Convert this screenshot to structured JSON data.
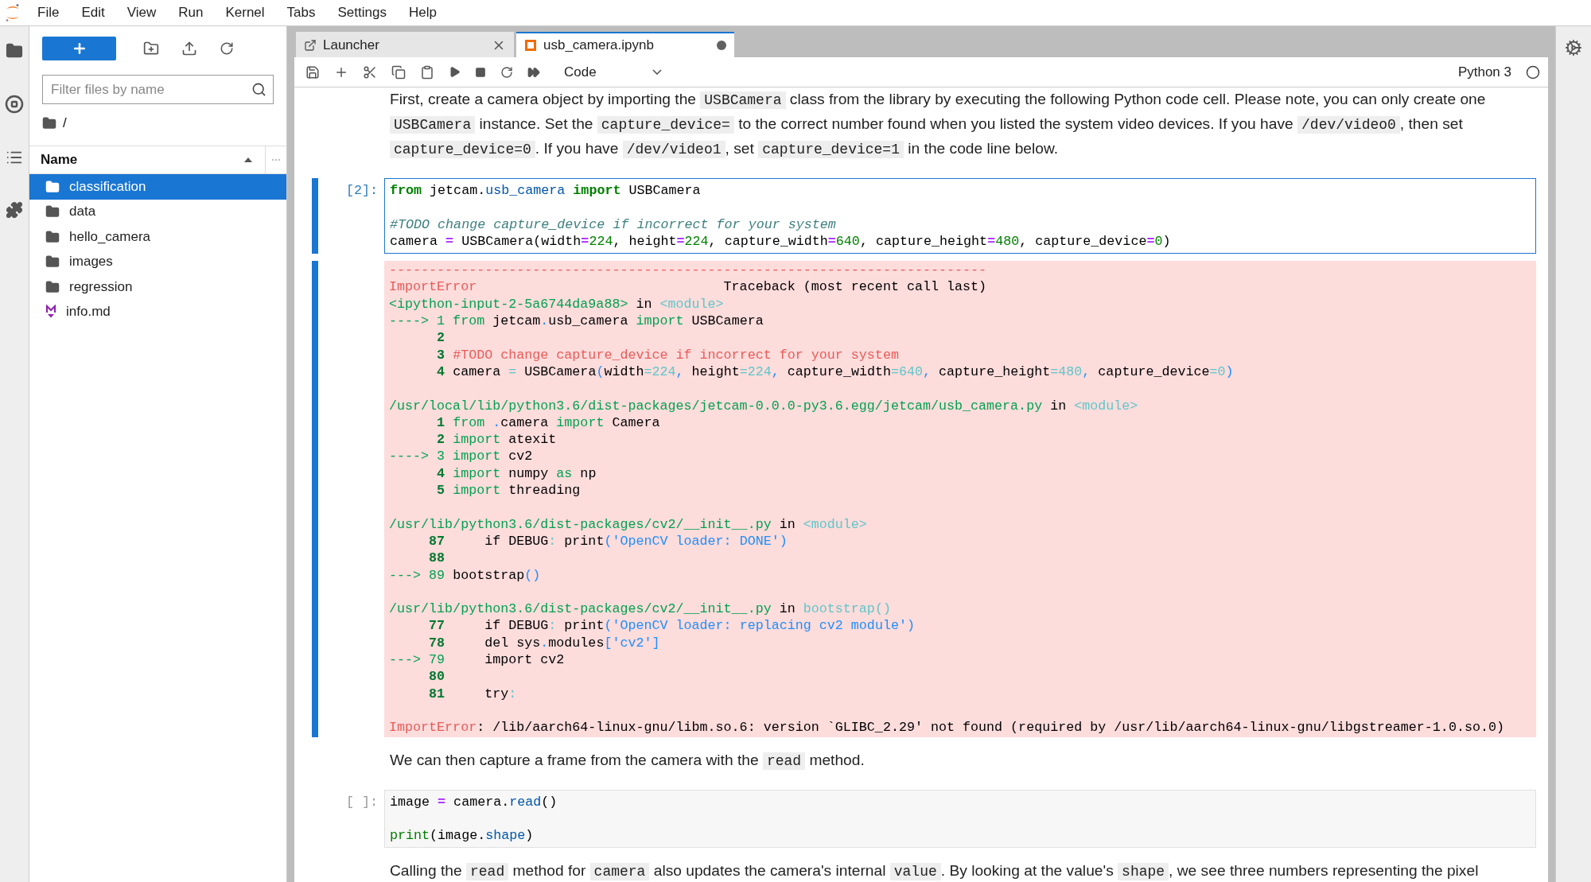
{
  "menu": [
    "File",
    "Edit",
    "View",
    "Run",
    "Kernel",
    "Tabs",
    "Settings",
    "Help"
  ],
  "file_browser": {
    "filter_placeholder": "Filter files by name",
    "path": "/",
    "column": "Name",
    "items": [
      {
        "name": "classification",
        "kind": "folder",
        "selected": true
      },
      {
        "name": "data",
        "kind": "folder",
        "selected": false
      },
      {
        "name": "hello_camera",
        "kind": "folder",
        "selected": false
      },
      {
        "name": "images",
        "kind": "folder",
        "selected": false
      },
      {
        "name": "regression",
        "kind": "folder",
        "selected": false
      },
      {
        "name": "info.md",
        "kind": "markdown",
        "selected": false
      }
    ]
  },
  "tabs": [
    {
      "label": "Launcher",
      "kind": "launcher",
      "selected": false,
      "modified": false
    },
    {
      "label": "usb_camera.ipynb",
      "kind": "notebook",
      "selected": true,
      "modified": true
    }
  ],
  "toolbar": {
    "cell_type": "Code",
    "kernel": "Python 3"
  },
  "cells": [
    {
      "kind": "markdown",
      "segments": [
        {
          "text": "First, create a camera object by importing the ",
          "kind": "text"
        },
        {
          "text": "USBCamera",
          "kind": "code"
        },
        {
          "text": " class from the library by executing the following Python code cell. Please note, you can only create one ",
          "kind": "text"
        },
        {
          "text": "USBCamera",
          "kind": "code"
        },
        {
          "text": " instance. Set the ",
          "kind": "text"
        },
        {
          "text": "capture_device=",
          "kind": "code"
        },
        {
          "text": " to the correct number found when you listed the system video devices. If you have ",
          "kind": "text"
        },
        {
          "text": "/dev/video0",
          "kind": "code"
        },
        {
          "text": ", then set ",
          "kind": "text"
        },
        {
          "text": "capture_device=0",
          "kind": "code"
        },
        {
          "text": ". If you have ",
          "kind": "text"
        },
        {
          "text": "/dev/video1",
          "kind": "code"
        },
        {
          "text": ", set ",
          "kind": "text"
        },
        {
          "text": "capture_device=1",
          "kind": "code"
        },
        {
          "text": " in the code line below.",
          "kind": "text"
        }
      ]
    },
    {
      "kind": "code",
      "prompt": "[2]:",
      "active": true,
      "groups": [
        [
          [
            {
              "text": "from",
              "kind": "kw"
            },
            {
              "text": " jetcam.",
              "kind": "plain"
            },
            {
              "text": "usb_camera",
              "kind": "mod"
            },
            {
              "text": " import",
              "kind": "kw"
            },
            {
              "text": " USBCamera",
              "kind": "plain"
            }
          ]
        ],
        [
          [
            {
              "text": "#TODO change capture_device if incorrect for your system",
              "kind": "comment"
            }
          ],
          [
            {
              "text": "camera ",
              "kind": "plain"
            },
            {
              "text": "=",
              "kind": "op"
            },
            {
              "text": " USBCamera(width",
              "kind": "plain"
            },
            {
              "text": "=",
              "kind": "op"
            },
            {
              "text": "224",
              "kind": "num"
            },
            {
              "text": ", height",
              "kind": "plain"
            },
            {
              "text": "=",
              "kind": "op"
            },
            {
              "text": "224",
              "kind": "num"
            },
            {
              "text": ", capture_width",
              "kind": "plain"
            },
            {
              "text": "=",
              "kind": "op"
            },
            {
              "text": "640",
              "kind": "num"
            },
            {
              "text": ", capture_height",
              "kind": "plain"
            },
            {
              "text": "=",
              "kind": "op"
            },
            {
              "text": "480",
              "kind": "num"
            },
            {
              "text": ", capture_device",
              "kind": "plain"
            },
            {
              "text": "=",
              "kind": "op"
            },
            {
              "text": "0",
              "kind": "num"
            },
            {
              "text": ")",
              "kind": "plain"
            }
          ]
        ]
      ],
      "output": {
        "kind": "error",
        "groups": [
          [
            [
              {
                "text": "---------------------------------------------------------------------------",
                "kind": "red"
              }
            ],
            [
              {
                "text": "ImportError",
                "kind": "red"
              },
              {
                "text": "                               Traceback (most recent call last)",
                "kind": "plain"
              }
            ],
            [
              {
                "text": "<ipython-input-2-5a6744da9a88>",
                "kind": "green"
              },
              {
                "text": " in ",
                "kind": "plain"
              },
              {
                "text": "<module>",
                "kind": "cyan"
              }
            ],
            [
              {
                "text": "----> 1 from",
                "kind": "green"
              },
              {
                "text": " jetcam",
                "kind": "plain"
              },
              {
                "text": ".",
                "kind": "blue"
              },
              {
                "text": "usb_camera ",
                "kind": "plain"
              },
              {
                "text": "import",
                "kind": "green"
              },
              {
                "text": " USBCamera",
                "kind": "plain"
              }
            ],
            [
              {
                "text": "      2",
                "kind": "greenbold"
              }
            ],
            [
              {
                "text": "      3 ",
                "kind": "greenbold"
              },
              {
                "text": "#TODO change capture_device if incorrect for your system",
                "kind": "red"
              }
            ],
            [
              {
                "text": "      4 ",
                "kind": "greenbold"
              },
              {
                "text": "camera ",
                "kind": "plain"
              },
              {
                "text": "=",
                "kind": "cyan"
              },
              {
                "text": " USBCamera",
                "kind": "plain"
              },
              {
                "text": "(",
                "kind": "blue"
              },
              {
                "text": "width",
                "kind": "plain"
              },
              {
                "text": "=224",
                "kind": "cyan"
              },
              {
                "text": ", ",
                "kind": "blue"
              },
              {
                "text": "height",
                "kind": "plain"
              },
              {
                "text": "=224",
                "kind": "cyan"
              },
              {
                "text": ", ",
                "kind": "blue"
              },
              {
                "text": "capture_width",
                "kind": "plain"
              },
              {
                "text": "=640",
                "kind": "cyan"
              },
              {
                "text": ", ",
                "kind": "blue"
              },
              {
                "text": "capture_height",
                "kind": "plain"
              },
              {
                "text": "=480",
                "kind": "cyan"
              },
              {
                "text": ", ",
                "kind": "blue"
              },
              {
                "text": "capture_device",
                "kind": "plain"
              },
              {
                "text": "=0",
                "kind": "cyan"
              },
              {
                "text": ")",
                "kind": "blue"
              }
            ]
          ],
          [
            [
              {
                "text": "/usr/local/lib/python3.6/dist-packages/jetcam-0.0.0-py3.6.egg/jetcam/usb_camera.py",
                "kind": "green"
              },
              {
                "text": " in ",
                "kind": "plain"
              },
              {
                "text": "<module>",
                "kind": "cyan"
              }
            ],
            [
              {
                "text": "      1 ",
                "kind": "greenbold"
              },
              {
                "text": "from",
                "kind": "green"
              },
              {
                "text": " .",
                "kind": "blue"
              },
              {
                "text": "camera ",
                "kind": "plain"
              },
              {
                "text": "import",
                "kind": "green"
              },
              {
                "text": " Camera",
                "kind": "plain"
              }
            ],
            [
              {
                "text": "      2 ",
                "kind": "greenbold"
              },
              {
                "text": "import",
                "kind": "green"
              },
              {
                "text": " atexit",
                "kind": "plain"
              }
            ],
            [
              {
                "text": "----> 3 import",
                "kind": "green"
              },
              {
                "text": " cv2",
                "kind": "plain"
              }
            ],
            [
              {
                "text": "      4 ",
                "kind": "greenbold"
              },
              {
                "text": "import",
                "kind": "green"
              },
              {
                "text": " numpy ",
                "kind": "plain"
              },
              {
                "text": "as",
                "kind": "green"
              },
              {
                "text": " np",
                "kind": "plain"
              }
            ],
            [
              {
                "text": "      5 ",
                "kind": "greenbold"
              },
              {
                "text": "import",
                "kind": "green"
              },
              {
                "text": " threading",
                "kind": "plain"
              }
            ]
          ],
          [
            [
              {
                "text": "/usr/lib/python3.6/dist-packages/cv2/__init__.py",
                "kind": "green"
              },
              {
                "text": " in ",
                "kind": "plain"
              },
              {
                "text": "<module>",
                "kind": "cyan"
              }
            ],
            [
              {
                "text": "     87 ",
                "kind": "greenbold"
              },
              {
                "text": "    if DEBUG",
                "kind": "plain"
              },
              {
                "text": ": ",
                "kind": "cyan"
              },
              {
                "text": "print",
                "kind": "plain"
              },
              {
                "text": "('OpenCV loader: DONE')",
                "kind": "blue"
              }
            ],
            [
              {
                "text": "     88",
                "kind": "greenbold"
              }
            ],
            [
              {
                "text": "---> 89 ",
                "kind": "green"
              },
              {
                "text": "bootstrap",
                "kind": "plain"
              },
              {
                "text": "()",
                "kind": "blue"
              }
            ]
          ],
          [
            [
              {
                "text": "/usr/lib/python3.6/dist-packages/cv2/__init__.py",
                "kind": "green"
              },
              {
                "text": " in ",
                "kind": "plain"
              },
              {
                "text": "bootstrap()",
                "kind": "cyan"
              }
            ],
            [
              {
                "text": "     77 ",
                "kind": "greenbold"
              },
              {
                "text": "    if DEBUG",
                "kind": "plain"
              },
              {
                "text": ": ",
                "kind": "cyan"
              },
              {
                "text": "print",
                "kind": "plain"
              },
              {
                "text": "('OpenCV loader: replacing cv2 module')",
                "kind": "blue"
              }
            ],
            [
              {
                "text": "     78 ",
                "kind": "greenbold"
              },
              {
                "text": "    del sys",
                "kind": "plain"
              },
              {
                "text": ".",
                "kind": "blue"
              },
              {
                "text": "modules",
                "kind": "plain"
              },
              {
                "text": "['cv2']",
                "kind": "blue"
              }
            ],
            [
              {
                "text": "---> 79 ",
                "kind": "green"
              },
              {
                "text": "    import cv2",
                "kind": "plain"
              }
            ],
            [
              {
                "text": "     80",
                "kind": "greenbold"
              }
            ],
            [
              {
                "text": "     81 ",
                "kind": "greenbold"
              },
              {
                "text": "    try",
                "kind": "plain"
              },
              {
                "text": ":",
                "kind": "cyan"
              }
            ]
          ],
          [
            [
              {
                "text": "ImportError",
                "kind": "red"
              },
              {
                "text": ": /lib/aarch64-linux-gnu/libm.so.6: version `GLIBC_2.29' not found (required by /usr/lib/aarch64-linux-gnu/libgstreamer-1.0.so.0)",
                "kind": "plain"
              }
            ]
          ]
        ]
      }
    },
    {
      "kind": "markdown",
      "segments": [
        {
          "text": "We can then capture a frame from the camera with the ",
          "kind": "text"
        },
        {
          "text": "read",
          "kind": "code"
        },
        {
          "text": " method.",
          "kind": "text"
        }
      ]
    },
    {
      "kind": "code",
      "prompt": "[ ]:",
      "active": false,
      "groups": [
        [
          [
            {
              "text": "image ",
              "kind": "plain"
            },
            {
              "text": "=",
              "kind": "op"
            },
            {
              "text": " camera.",
              "kind": "plain"
            },
            {
              "text": "read",
              "kind": "attr"
            },
            {
              "text": "()",
              "kind": "plain"
            }
          ]
        ],
        [
          [
            {
              "text": "print",
              "kind": "builtin"
            },
            {
              "text": "(image.",
              "kind": "plain"
            },
            {
              "text": "shape",
              "kind": "attr"
            },
            {
              "text": ")",
              "kind": "plain"
            }
          ]
        ]
      ]
    },
    {
      "kind": "markdown",
      "segments": [
        {
          "text": "Calling the ",
          "kind": "text"
        },
        {
          "text": "read",
          "kind": "code"
        },
        {
          "text": " method for ",
          "kind": "text"
        },
        {
          "text": "camera",
          "kind": "code"
        },
        {
          "text": " also updates the camera's internal ",
          "kind": "text"
        },
        {
          "text": "value",
          "kind": "code"
        },
        {
          "text": ". By looking at the value's ",
          "kind": "text"
        },
        {
          "text": "shape",
          "kind": "code"
        },
        {
          "text": ", we see three numbers representing the pixel",
          "kind": "text"
        }
      ]
    }
  ]
}
